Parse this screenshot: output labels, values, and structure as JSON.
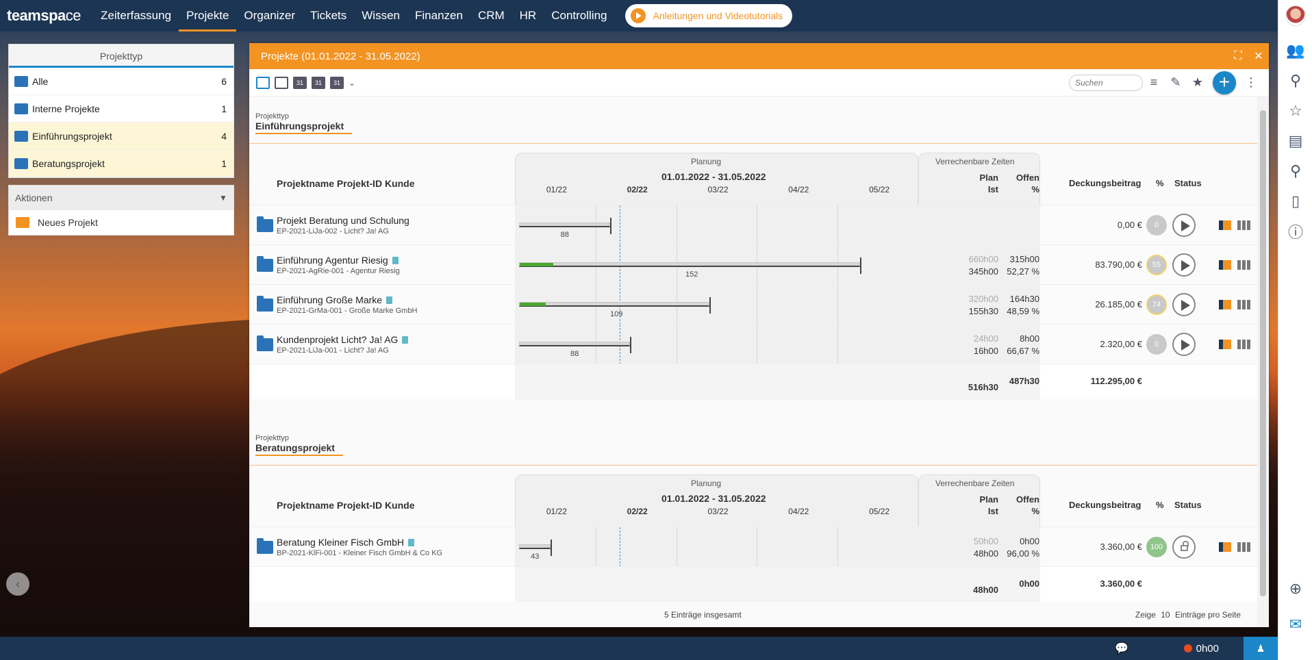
{
  "topbar": {
    "logo_bold": "teamspa",
    "logo_rest": "ce",
    "nav": [
      "Zeiterfassung",
      "Projekte",
      "Organizer",
      "Tickets",
      "Wissen",
      "Finanzen",
      "CRM",
      "HR",
      "Controlling"
    ],
    "active_nav": "Projekte",
    "tutorial_label": "Anleitungen und Videotutorials"
  },
  "left": {
    "projekttyp_title": "Projekttyp",
    "types": [
      {
        "label": "Alle",
        "count": "6"
      },
      {
        "label": "Interne Projekte",
        "count": "1"
      },
      {
        "label": "Einführungsprojekt",
        "count": "4"
      },
      {
        "label": "Beratungsprojekt",
        "count": "1"
      }
    ],
    "aktionen_title": "Aktionen",
    "neues_projekt": "Neues Projekt"
  },
  "window": {
    "title": "Projekte (01.01.2022 - 31.05.2022)",
    "search_placeholder": "Suchen"
  },
  "table_headers": {
    "col_name": "Projektname Projekt-ID Kunde",
    "planung": "Planung",
    "range": "01.01.2022 - 31.05.2022",
    "months": [
      "01/22",
      "02/22",
      "03/22",
      "04/22",
      "05/22"
    ],
    "verrechenbare": "Verrechenbare Zeiten",
    "plan": "Plan",
    "ist": "Ist",
    "offen": "Offen",
    "pct": "%",
    "deckungsbeitrag": "Deckungsbeitrag",
    "pct2": "%",
    "status": "Status"
  },
  "groups": [
    {
      "small": "Projekttyp",
      "title": "Einführungsprojekt",
      "rows": [
        {
          "name": "Projekt Beratung und Schulung",
          "sub": "EP-2021-LiJa-002 - Licht? Ja! AG",
          "bar_start": 0.0,
          "bar_end": 0.23,
          "progress": 0.0,
          "bar_label": "88",
          "plan": "",
          "ist": "",
          "offen": "",
          "offen_pct": "",
          "db": "0,00 €",
          "pct": "0",
          "pct_style": "grey",
          "status": "play",
          "doc": false
        },
        {
          "name": "Einführung Agentur Riesig",
          "sub": "EP-2021-AgRie-001 - Agentur Riesig",
          "bar_start": 0.0,
          "bar_end": 0.86,
          "progress": 0.085,
          "bar_label": "152",
          "plan": "660h00",
          "ist": "345h00",
          "offen": "315h00",
          "offen_pct": "52,27 %",
          "db": "83.790,00 €",
          "pct": "55",
          "pct_style": "yellow",
          "status": "play",
          "doc": true
        },
        {
          "name": "Einführung Große Marke",
          "sub": "EP-2021-GrMa-001 - Große Marke GmbH",
          "bar_start": 0.0,
          "bar_end": 0.48,
          "progress": 0.066,
          "bar_label": "109",
          "plan": "320h00",
          "ist": "155h30",
          "offen": "164h30",
          "offen_pct": "48,59 %",
          "db": "26.185,00 €",
          "pct": "74",
          "pct_style": "yellow",
          "status": "play",
          "doc": true
        },
        {
          "name": "Kundenprojekt Licht? Ja! AG",
          "sub": "EP-2021-LiJa-001 - Licht? Ja! AG",
          "bar_start": 0.0,
          "bar_end": 0.28,
          "progress": 0.0,
          "bar_label": "88",
          "plan": "24h00",
          "ist": "16h00",
          "offen": "8h00",
          "offen_pct": "66,67 %",
          "db": "2.320,00 €",
          "pct": "0",
          "pct_style": "grey",
          "status": "play",
          "doc": true
        }
      ],
      "sum_plan": "516h30",
      "sum_offen": "487h30",
      "sum_db": "112.295,00 €"
    },
    {
      "small": "Projekttyp",
      "title": "Beratungsprojekt",
      "rows": [
        {
          "name": "Beratung Kleiner Fisch GmbH",
          "sub": "BP-2021-KlFi-001 - Kleiner Fisch GmbH & Co KG",
          "bar_start": 0.0,
          "bar_end": 0.08,
          "progress": 0.0,
          "bar_label": "43",
          "plan": "50h00",
          "ist": "48h00",
          "offen": "0h00",
          "offen_pct": "96,00 %",
          "db": "3.360,00 €",
          "pct": "100",
          "pct_style": "green",
          "status": "lock",
          "doc": true
        }
      ],
      "sum_plan": "48h00",
      "sum_offen": "0h00",
      "sum_db": "3.360,00 €"
    }
  ],
  "footer": {
    "total": "5 Einträge insgesamt",
    "zeige": "Zeige",
    "per_page": "10",
    "per_page_label": "Einträge pro Seite"
  },
  "bottombar": {
    "time": "0h00"
  },
  "colors": {
    "accent": "#f39322",
    "navy": "#1c3553",
    "blue": "#1b86c8",
    "progress": "#4aa82e"
  }
}
